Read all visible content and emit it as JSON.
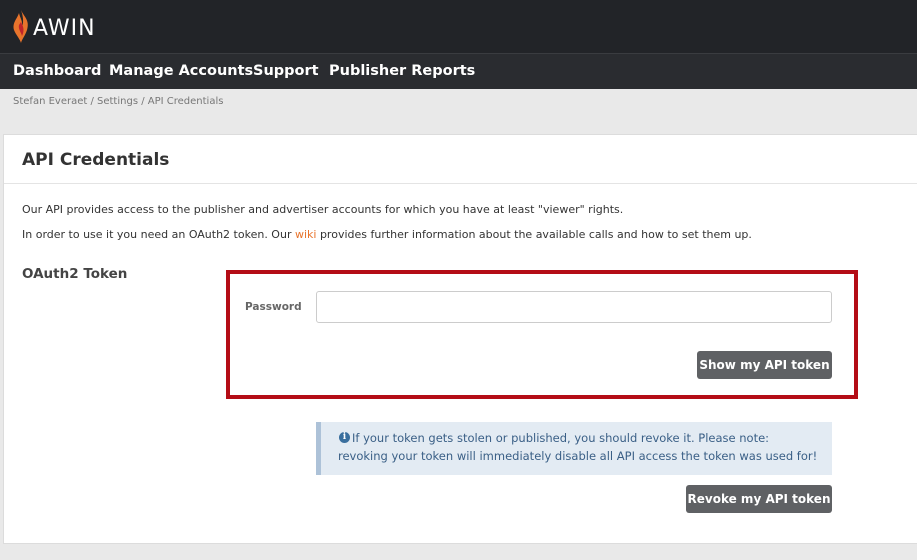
{
  "brand": {
    "name": "AWIN",
    "logo_icon": "flame-logo-icon"
  },
  "nav": {
    "items": [
      {
        "label": "Dashboard"
      },
      {
        "label": "Manage Accounts"
      },
      {
        "label": "Support"
      },
      {
        "label": "Publisher Reports"
      }
    ]
  },
  "breadcrumb": "Stefan Everaet / Settings / API Credentials",
  "page": {
    "title": "API Credentials",
    "intro_1": "Our API provides access to the publisher and advertiser accounts for which you have at least \"viewer\" rights.",
    "intro_2_before": "In order to use it you need an OAuth2 token. Our ",
    "intro_2_link": "wiki",
    "intro_2_after": " provides further information about the available calls and how to set them up."
  },
  "oauth": {
    "section_label": "OAuth2 Token",
    "password_label": "Password",
    "password_value": "",
    "show_button": "Show my API token",
    "alert_icon": "info-circle-icon",
    "alert_line_1": "If your token gets stolen or published, you should revoke it. Please note:",
    "alert_line_2": "revoking your token will immediately disable all API access the token was used for!",
    "revoke_button": "Revoke my API token"
  },
  "colors": {
    "topbar": "#222428",
    "link": "#e8742c",
    "highlight": "#b40d16",
    "button": "#5f6164",
    "alert_bg": "#e3ebf3"
  }
}
